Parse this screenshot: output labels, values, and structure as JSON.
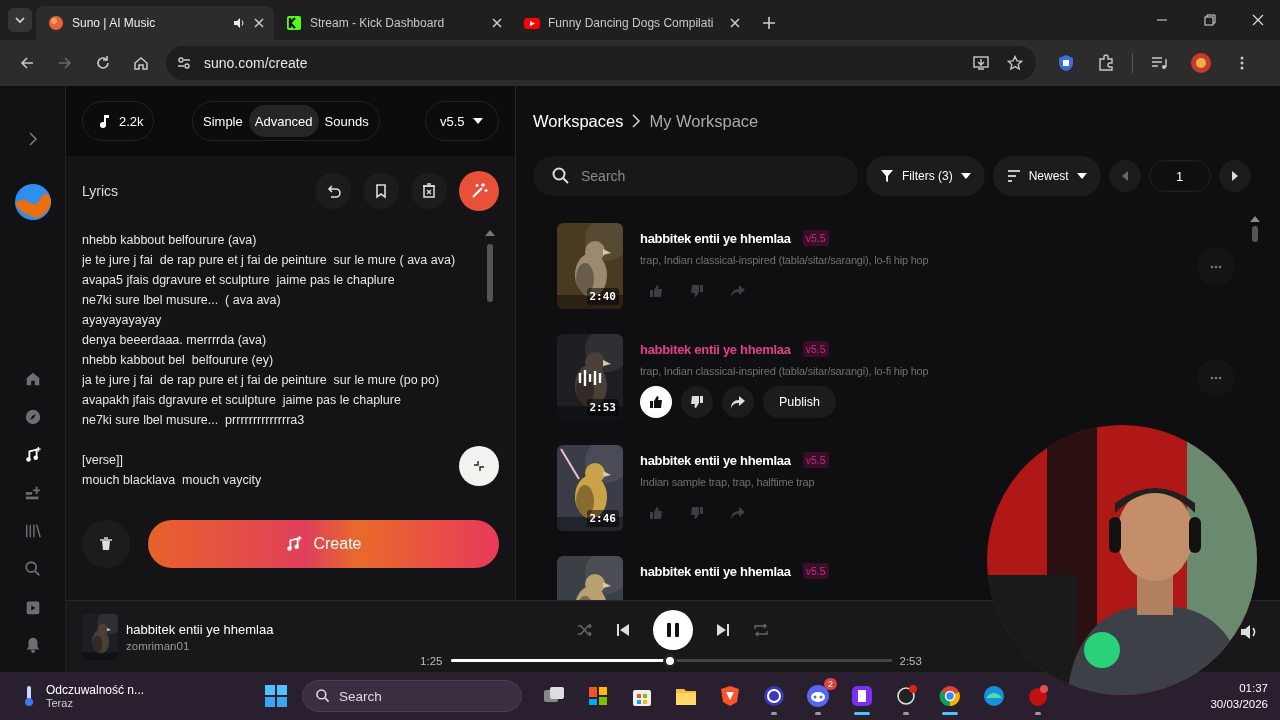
{
  "browser": {
    "tabs": [
      {
        "title": "Suno | AI Music",
        "selected": true,
        "audio": true
      },
      {
        "title": "Stream - Kick Dashboard",
        "selected": false,
        "audio": false
      },
      {
        "title": "Funny Dancing Dogs Compilati",
        "selected": false,
        "audio": false
      }
    ],
    "url": "suno.com/create"
  },
  "sidebar": {
    "items": [
      {
        "selected": false
      },
      {
        "selected": false
      },
      {
        "selected": true
      },
      {
        "selected": false
      },
      {
        "selected": false
      },
      {
        "selected": false
      },
      {
        "selected": false
      },
      {
        "selected": false
      }
    ]
  },
  "create_panel": {
    "credits": "2.2k",
    "modes": [
      {
        "label": "Simple",
        "selected": false
      },
      {
        "label": "Advanced",
        "selected": true
      },
      {
        "label": "Sounds",
        "selected": false
      }
    ],
    "model": "v5.5",
    "lyrics_label": "Lyrics",
    "lyrics": [
      [
        "nhebb kabbout belfourure (ava)",
        "je te jure j fai  de rap pure et j fai de peinture  sur le mure ( ava ava)",
        "avapa5 jfais dgravure et sculpture  jaime pas le chaplure",
        "ne7ki sure lbel musure...  ( ava ava)",
        "ayayayayayay",
        "denya beeerdaaa. merrrrda (ava)",
        "nhebb kabbout bel  belfourure (ey)",
        "ja te jure j fai  de rap pure et j fai de peinture  sur le mure (po po)",
        "avapakh jfais dgravure et sculpture  jaime pas le chaplure",
        "ne7ki sure lbel musure...  prrrrrrrrrrrrrra3"
      ],
      [
        "[verse]]",
        "mouch blacklava  mouch vaycity"
      ]
    ],
    "create_label": "Create"
  },
  "workspace": {
    "breadcrumb": [
      "Workspaces",
      "My Workspace"
    ],
    "search": {
      "placeholder": "Search"
    },
    "filters": "Filters (3)",
    "sort": "Newest",
    "page": "1",
    "songs": [
      {
        "title": "habbitek entii ye hhemlaa",
        "version": "v5.5",
        "tags": "trap, Indian classical-inspired (tabla/sitar/sarangi), lo-fi hip hop",
        "duration": "2:40",
        "playing": false,
        "liked": false,
        "more_button": true
      },
      {
        "title": "habbitek entii ye hhemlaa",
        "version": "v5.5",
        "tags": "trap, Indian classical-inspired (tabla/sitar/sarangi), lo-fi hip hop",
        "duration": "2:53",
        "playing": true,
        "liked": true,
        "publish": "Publish",
        "more_button": true
      },
      {
        "title": "habbitek entii ye hhemlaa",
        "version": "v5.5",
        "tags": "Indian sample trap, trap, halftime trap",
        "duration": "2:46",
        "playing": false,
        "liked": false
      },
      {
        "title": "habbitek entii ye hhemlaa",
        "version": "v5.5",
        "playing": false
      }
    ]
  },
  "player": {
    "title": "habbitek entii ye hhemlaa",
    "artist": "zomriman01",
    "elapsed": "1:25",
    "total": "2:53",
    "level": 0.497,
    "playing": true
  },
  "taskbar": {
    "weather": "Odczuwalność n...",
    "weather_sub": "Teraz",
    "search_placeholder": "Search",
    "apps": [
      {
        "running": false
      },
      {
        "running": false
      },
      {
        "running": false
      },
      {
        "running": false
      },
      {
        "running": false
      },
      {
        "running": true,
        "active": false
      },
      {
        "running": true,
        "active": false,
        "badge": "2"
      },
      {
        "running": true,
        "active": true
      },
      {
        "running": true,
        "active": false
      },
      {
        "running": true,
        "active": true
      },
      {
        "running": false
      },
      {
        "running": true,
        "active": false
      }
    ],
    "time": "01:37",
    "date": "30/03/2026"
  }
}
